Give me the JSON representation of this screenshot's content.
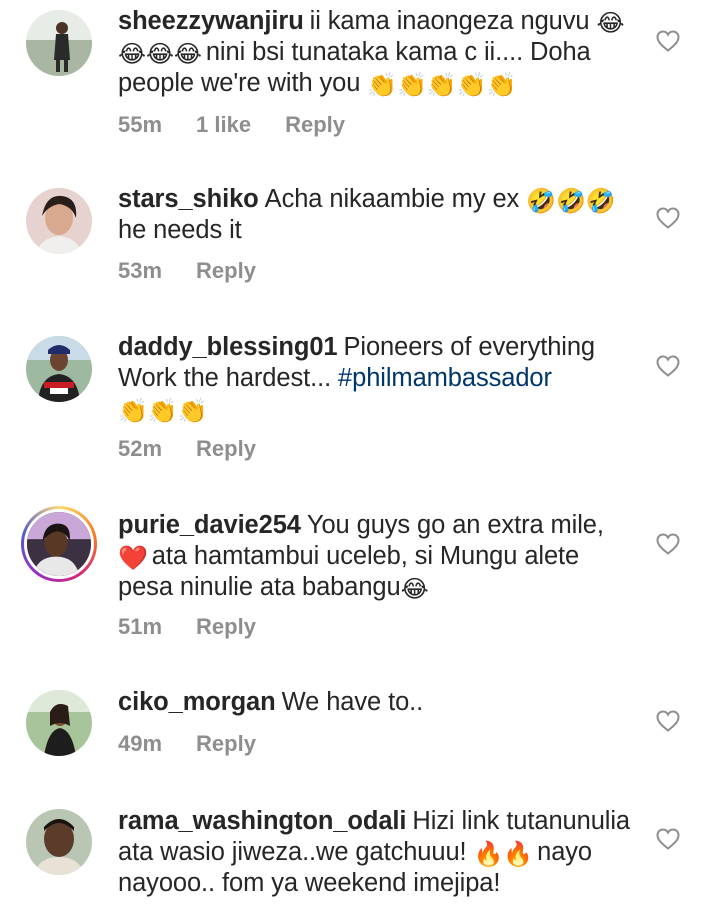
{
  "comments": [
    {
      "username": "sheezzywanjiru",
      "text_1": "ii kama inaongeza nguvu ",
      "emoji_1": "😂",
      "emoji_2": "😂😂😂",
      "text_2": "nini bsi tunataka kama c ii.... Doha people we're with you ",
      "emoji_3": "👏👏👏👏👏",
      "time": "55m",
      "likes": "1 like",
      "reply": "Reply",
      "like_icon": "heart-outline-icon"
    },
    {
      "username": "stars_shiko",
      "text_1": "Acha nikaambie my ex ",
      "emoji_1": "🤣🤣🤣",
      "text_2": "he needs it",
      "time": "53m",
      "reply": "Reply",
      "like_icon": "heart-outline-icon"
    },
    {
      "username": "daddy_blessing01",
      "text_1": "Pioneers of everything Work the hardest... ",
      "hashtag": "#philmambassador",
      "emoji_1": "👏👏👏",
      "time": "52m",
      "reply": "Reply",
      "like_icon": "heart-outline-icon"
    },
    {
      "username": "purie_davie254",
      "text_1": "You guys go an extra mile, ",
      "emoji_1": "❤️",
      "text_2": "ata hamtambui uceleb, si Mungu alete pesa ninulie ata babangu",
      "emoji_2": "😂",
      "time": "51m",
      "reply": "Reply",
      "like_icon": "heart-outline-icon"
    },
    {
      "username": "ciko_morgan",
      "text_1": "We have to..",
      "time": "49m",
      "reply": "Reply",
      "like_icon": "heart-outline-icon"
    },
    {
      "username": "rama_washington_odali",
      "text_1": "Hizi link tutanunulia ata wasio jiweza..we gatchuuu! ",
      "emoji_1": "🔥🔥",
      "text_2": "nayo nayooo.. fom ya weekend imejipa!",
      "like_icon": "heart-outline-icon"
    }
  ]
}
